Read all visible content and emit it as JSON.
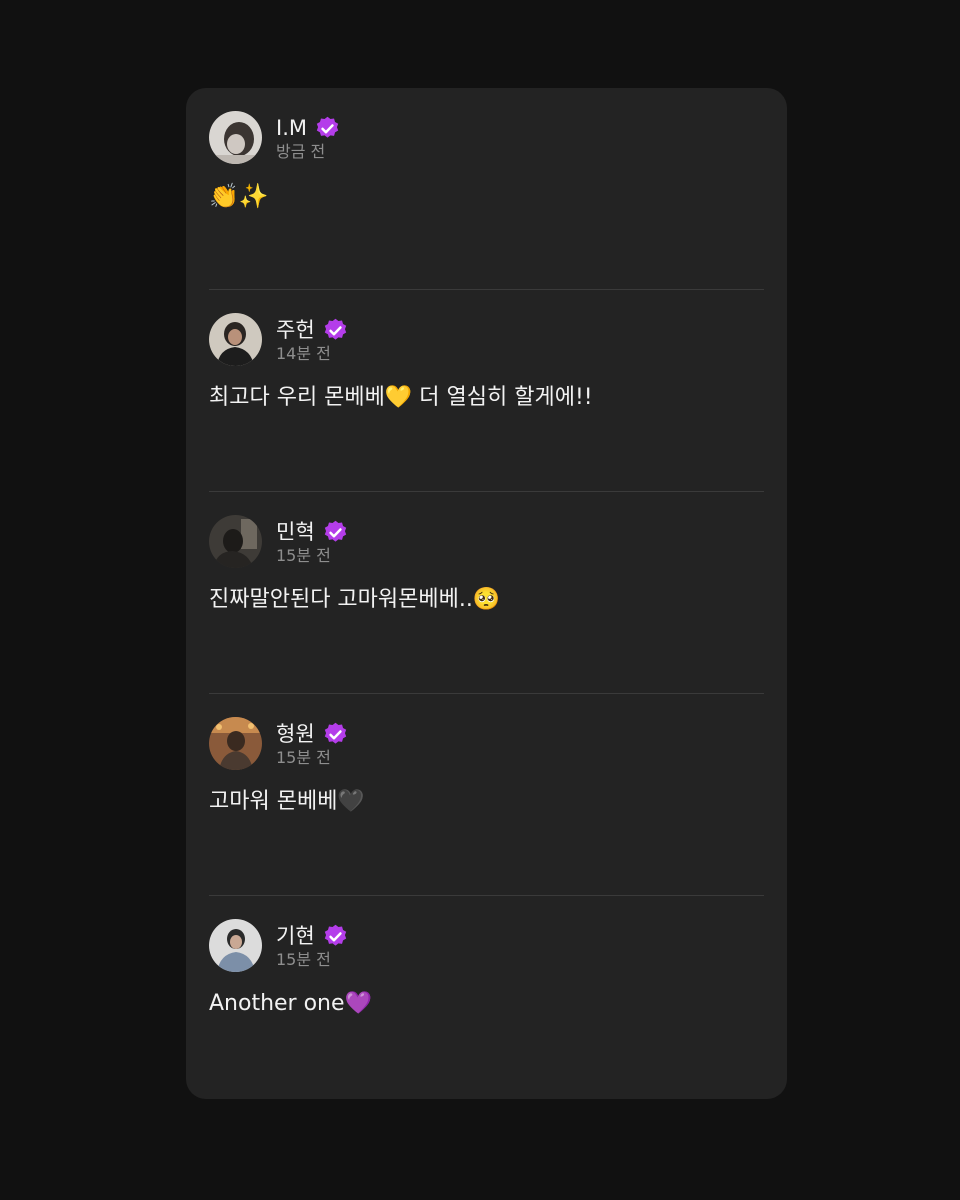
{
  "colors": {
    "page_background": "#111111",
    "card_background": "#232323",
    "verified_badge": "#b43dea",
    "divider": "#3a3a3a"
  },
  "posts": [
    {
      "author": "I.M",
      "time": "방금 전",
      "text": "👏✨",
      "avatar_icon": "avatar-photo-icon"
    },
    {
      "author": "주헌",
      "time": "14분 전",
      "text": "최고다 우리 몬베베💛 더 열심히 할게에!!",
      "avatar_icon": "avatar-photo-icon"
    },
    {
      "author": "민혁",
      "time": "15분 전",
      "text": "진짜말안된다 고마워몬베베..🥺",
      "avatar_icon": "avatar-photo-icon"
    },
    {
      "author": "형원",
      "time": "15분 전",
      "text": "고마워 몬베베🖤",
      "avatar_icon": "avatar-photo-icon"
    },
    {
      "author": "기현",
      "time": "15분 전",
      "text": "Another one💜",
      "avatar_icon": "avatar-photo-icon"
    }
  ]
}
